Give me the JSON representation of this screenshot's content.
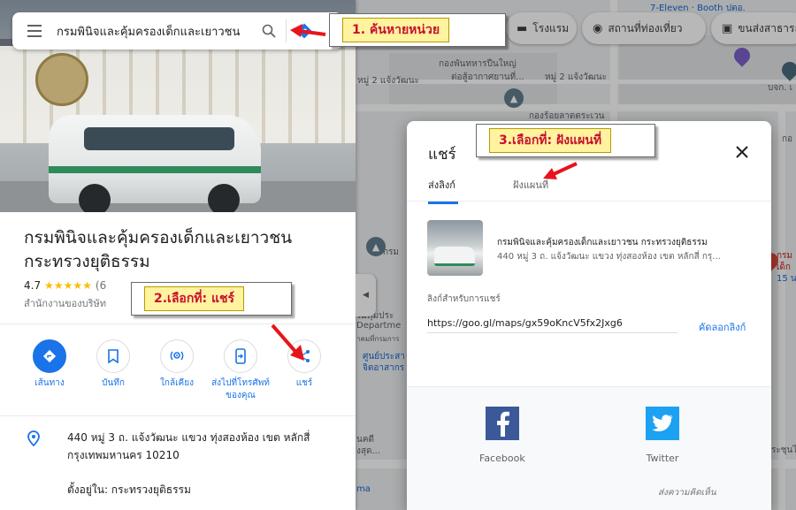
{
  "search": {
    "value": "กรมพินิจและคุ้มครองเด็กและเยาวชน"
  },
  "chips": [
    {
      "icon": "hotel-icon",
      "label": "โรงแรม"
    },
    {
      "icon": "camera-icon",
      "label": "สถานที่ท่องเที่ยว"
    },
    {
      "icon": "transit-icon",
      "label": "ขนส่งสาธารณะ"
    }
  ],
  "map_labels": {
    "seven_eleven": "7-Eleven · Booth ปตอ.",
    "military_office": "กองพันทหารปืนใหญ่",
    "military_sub": "ต่อสู้อากาศยานที่...",
    "street_left": "หมู่ 2 แจ้งวัฒนะ",
    "street_right": "หมู่ 2 แจ้งวัฒนะ",
    "company": "กองร้อยลาดตระเวน",
    "bkt": "บจก. เ",
    "kao": "กอ",
    "krom_left": "กรม",
    "dept_1": "รมคุมประ",
    "dept_2": "Departme",
    "dept_3": "าคมที่กรมการ",
    "center_1": "ศูนย์ประสา",
    "center_2": "จิตอาสากร",
    "nakhon_1": "นคดี",
    "nakhon_2": "งสุด...",
    "ma": "ma",
    "krom_right_1": "กรม",
    "krom_right_2": "เด็ก",
    "krom_right_3": "15 น",
    "prachaniwet": "ระชุนไ"
  },
  "place": {
    "title": "กรมพินิจและคุ้มครองเด็กและเยาวชน กระทรวงยุติธรรม",
    "rating": "4.7",
    "stars": "★★★★★",
    "rating_count": "(6",
    "category": "สำนักงานของบริษัท",
    "address": "440 หมู่ 3 ถ. แจ้งวัฒนะ แขวง ทุ่งสองห้อง เขต หลักสี่ กรุงเทพมหานคร 10210",
    "located_in": "ตั้งอยู่ใน: กระทรวงยุติธรรม"
  },
  "actions": [
    {
      "name": "directions",
      "label": "เส้นทาง"
    },
    {
      "name": "save",
      "label": "บันทึก"
    },
    {
      "name": "nearby",
      "label": "ใกล้เคียง"
    },
    {
      "name": "send-to-phone",
      "label": "ส่งไปที่โทรศัพท์ของคุณ"
    },
    {
      "name": "share",
      "label": "แชร์"
    }
  ],
  "dialog": {
    "title": "แชร์",
    "tab_send_link": "ส่งลิงก์",
    "tab_embed_map": "ฝังแผนที่",
    "preview_name": "กรมพินิจและคุ้มครองเด็กและเยาวชน กระทรวงยุติธรรม",
    "preview_address": "440 หมู่ 3 ถ. แจ้งวัฒนะ แขวง ทุ่งสองห้อง เขต หลักสี่ กรุ...",
    "link_label": "ลิงก์สำหรับการแชร์",
    "link_value": "https://goo.gl/maps/gx59oKncV5fx2Jxg6",
    "copy_link": "คัดลอกลิงก์",
    "facebook": "Facebook",
    "twitter": "Twitter",
    "feedback": "ส่งความคิดเห็น"
  },
  "annotations": {
    "step1": "1. ค้นหายหน่วย",
    "step2": "2.เลือกที่: แชร์",
    "step3": "3.เลือกที่: ฝังแผนที่",
    "arrow_color": "#e8141b"
  }
}
